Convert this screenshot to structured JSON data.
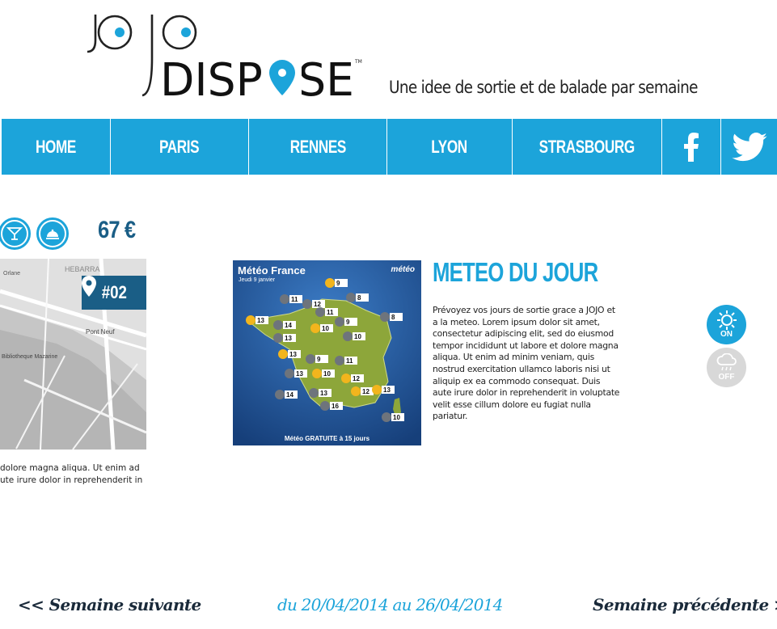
{
  "header": {
    "logo_top": "JOJO",
    "logo_bottom": "DISPOSE",
    "trademark": "TM",
    "tagline": "Une idee de sortie et de balade par semaine"
  },
  "nav": {
    "items": [
      {
        "label": "HOME"
      },
      {
        "label": "PARIS"
      },
      {
        "label": "RENNES"
      },
      {
        "label": "LYON"
      },
      {
        "label": "STRASBOURG"
      }
    ],
    "social": [
      "facebook-icon",
      "twitter-icon"
    ]
  },
  "outing": {
    "icons": [
      "cocktail-icon",
      "cloche-icon"
    ],
    "price": "67 €",
    "map_labels": [
      "Orlane",
      "HEBARRA",
      "Pont Neuf",
      "Bibliotheque Mazarine"
    ],
    "badge": "#02",
    "text_lines": [
      "dolore magna aliqua. Ut enim ad",
      "ute irure dolor in reprehenderit in"
    ]
  },
  "weather": {
    "image_title": "Météo France",
    "image_subtitle": "Jeudi 9 janvier",
    "image_brand": "météo",
    "image_footer": "Météo GRATUITE à 15 jours",
    "temperatures": [
      "9",
      "8",
      "11",
      "12",
      "13",
      "11",
      "8",
      "14",
      "10",
      "9",
      "13",
      "10",
      "13",
      "9",
      "11",
      "13",
      "10",
      "12",
      "14",
      "13",
      "12",
      "13",
      "16",
      "10"
    ],
    "title": "METEO DU JOUR",
    "text": "Prévoyez vos jours de sortie grace a JOJO et a la meteo. Lorem ipsum dolor sit amet, consectetur adipiscing elit, sed do eiusmod tempor incididunt ut labore et dolore magna aliqua. Ut enim ad minim veniam, quis nostrud exercitation ullamco laboris nisi ut aliquip ex ea commodo consequat. Duis aute irure dolor in reprehenderit in voluptate velit esse cillum dolore eu fugiat nulla pariatur.",
    "toggle_on": "ON",
    "toggle_off": "OFF"
  },
  "footer": {
    "next_week": "<< Semaine suivante",
    "range": "du 20/04/2014 au 26/04/2014",
    "prev_week": "Semaine précédente >>"
  },
  "colors": {
    "accent": "#1ca4da",
    "dark_blue": "#1a5e86",
    "off_grey": "#d8d8d8"
  }
}
